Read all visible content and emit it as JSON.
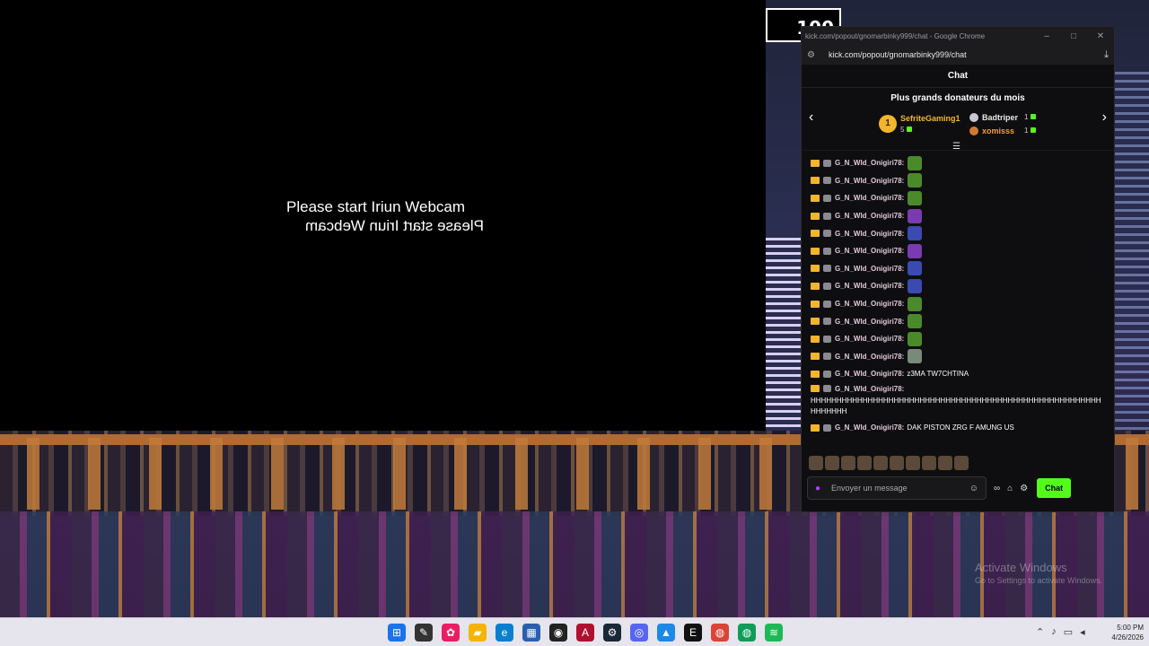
{
  "camera": {
    "line1": "Please start Iriun Webcam",
    "line2": "Please start Iriun Webcam"
  },
  "counter": {
    "value": "100"
  },
  "chrome": {
    "title": "kick.com/popout/gnomarbinky999/chat - Google Chrome",
    "url": "kick.com/popout/gnomarbinky999/chat",
    "controls": {
      "minimize": "–",
      "maximize": "□",
      "close": "✕"
    }
  },
  "chat": {
    "header": "Chat",
    "donors_title": "Plus grands donateurs du mois",
    "donors": [
      {
        "rank": "1",
        "name": "SefriteGaming1",
        "amount": "5"
      },
      {
        "name": "Badtriper",
        "amount": "1"
      },
      {
        "name": "xomisss",
        "amount": "1"
      }
    ],
    "username": "G_N_Wld_Onigiri78:",
    "msg_text_1": "z3MA TW7CHTINA",
    "msg_text_2": "HHHHHHHHHHHHHHHHHHHHHHHHHHHHHHHHHHHHHHHHHHHHHHHHHHHHHHHHHHHHHHH",
    "msg_text_3": "DAK PISTON ZRG F AMUNG US",
    "input_placeholder": "Envoyer un message",
    "send_label": "Chat",
    "accent": "#53fc18"
  },
  "watermark": {
    "title": "Activate Windows",
    "subtitle": "Go to Settings to activate Windows."
  },
  "taskbar": {
    "time": "5:00 PM",
    "date": "4/26/2026"
  }
}
